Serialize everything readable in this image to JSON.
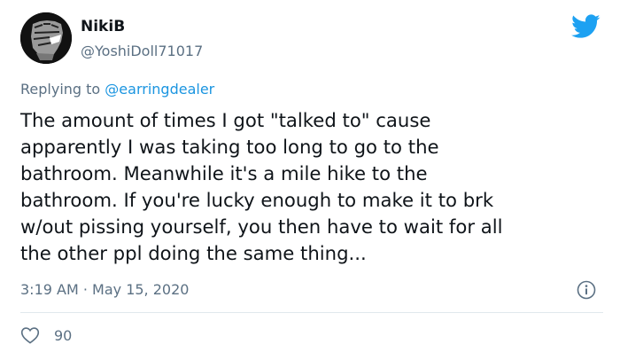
{
  "author": {
    "display_name": "NikiB",
    "handle": "@YoshiDoll71017",
    "avatar_icon": "raised-fist-avatar"
  },
  "reply": {
    "prefix": "Replying to ",
    "mention": "@earringdealer"
  },
  "tweet": {
    "text": "The amount of times I got \"talked to\" cause\napparently I was taking too long to go to the\nbathroom. Meanwhile it's a mile hike to the\nbathroom. If you're lucky enough to make it to brk\nw/out pissing yourself, you then have to wait for all\nthe other ppl doing the same thing..."
  },
  "meta": {
    "timestamp": "3:19 AM · May 15, 2020"
  },
  "actions": {
    "like_count": "90",
    "like_icon": "heart-icon",
    "info_icon": "info-icon"
  },
  "colors": {
    "brand": "#1da1f2",
    "muted": "#5b7083",
    "link": "#1b95e0"
  }
}
